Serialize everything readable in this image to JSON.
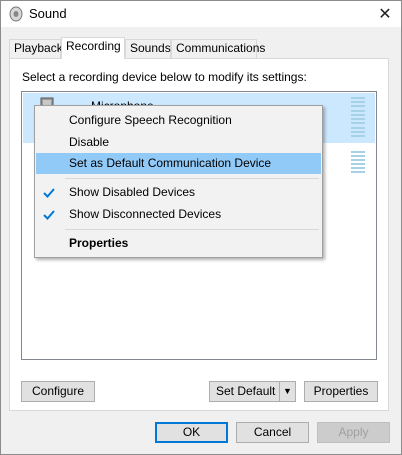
{
  "window": {
    "title": "Sound",
    "close_glyph": "✕"
  },
  "tabs": [
    {
      "label": "Playback",
      "active": false
    },
    {
      "label": "Recording",
      "active": true
    },
    {
      "label": "Sounds",
      "active": false
    },
    {
      "label": "Communications",
      "active": false
    }
  ],
  "panel": {
    "instruction": "Select a recording device below to modify its settings:",
    "devices": [
      {
        "name": "Microphone",
        "icon": "microphone-icon",
        "selected": true
      },
      {
        "name": "",
        "icon": "microphone-icon",
        "selected": false
      }
    ],
    "configure_label": "Configure",
    "set_default_label": "Set Default",
    "properties_label": "Properties"
  },
  "context_menu": {
    "items": [
      {
        "label": "Configure Speech Recognition",
        "checked": false,
        "highlighted": false,
        "bold": false
      },
      {
        "label": "Disable",
        "checked": false,
        "highlighted": false,
        "bold": false
      },
      {
        "label": "Set as Default Communication Device",
        "checked": false,
        "highlighted": true,
        "bold": false
      },
      {
        "label": "Show Disabled Devices",
        "checked": true,
        "highlighted": false,
        "bold": false
      },
      {
        "label": "Show Disconnected Devices",
        "checked": true,
        "highlighted": false,
        "bold": false
      },
      {
        "label": "Properties",
        "checked": false,
        "highlighted": false,
        "bold": true
      }
    ]
  },
  "footer": {
    "ok_label": "OK",
    "cancel_label": "Cancel",
    "apply_label": "Apply"
  },
  "colors": {
    "selection": "#cce8ff",
    "menu_highlight": "#91c9f7",
    "check": "#0078d7",
    "level_meter": "#a6d2e8",
    "default_button_border": "#0078d7"
  }
}
